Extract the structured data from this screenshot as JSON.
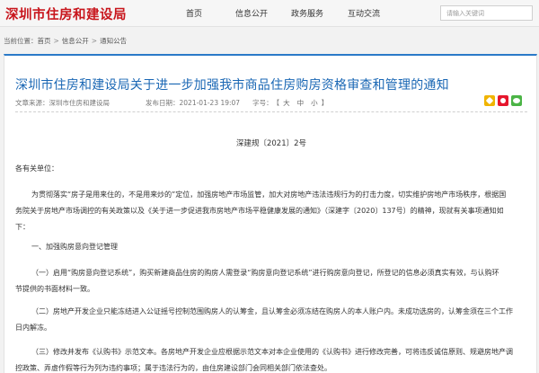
{
  "header": {
    "logo": "深圳市住房和建设局",
    "nav": [
      "首页",
      "信息公开",
      "政务服务",
      "互动交流"
    ],
    "search_placeholder": "请输入关键词"
  },
  "breadcrumb": {
    "prefix": "当前位置：",
    "items": [
      "首页",
      "信息公开",
      "通知公告"
    ],
    "separator": ">"
  },
  "article": {
    "title": "深圳市住房和建设局关于进一步加强我市商品住房购房资格审查和管理的通知",
    "source": "文章来源：深圳市住房和建设局",
    "date": "发布日期：2021-01-23 19:07",
    "font_label": "字号：",
    "font_open": "【",
    "font_sizes": [
      "大",
      "中",
      "小"
    ],
    "font_close": "】",
    "share_icons": [
      "qzone-icon",
      "weibo-icon",
      "wechat-icon"
    ],
    "doc_number": "深建规〔2021〕2号",
    "greeting": "各有关单位：",
    "p1_line1": "为贯彻落实“房子是用来住的，不是用来炒的”定位，加强房地产市场监管，加大对房地产违法违规行为的打击力度，切实维护房地产市场秩序，根据国",
    "p1_line2": "务院关于房地产市场调控的有关政策以及《关于进一步促进我市房地产市场平稳健康发展的通知》（深建字〔2020〕137号）的精神，现就有关事项通知如",
    "p1_line3": "下：",
    "section1": "一、加强购房意向登记管理",
    "p2_line1": "（一）启用“购房意向登记系统”，购买新建商品住房的购房人需登录“购房意向登记系统”进行购房意向登记，所登记的信息必须真实有效，与认购环",
    "p2_line2": "节提供的书面材料一致。",
    "p3_line1": "（二）房地产开发企业只能冻结进入公证摇号控制范围购房人的认筹金，且认筹金必须冻结在购房人的本人账户内。未成功选房的，认筹金须在三个工作",
    "p3_line2": "日内解冻。",
    "p4_line1": "（三）修改并发布《认购书》示范文本。各房地产开发企业应根据示范文本对本企业使用的《认购书》进行修改完善，可将违反诚信原则、规避房地产调",
    "p4_line2": "控政策、弄虚作假等行为列为违约事项；属于违法行为的，由住房建设部门会同相关部门依法查处。"
  },
  "colors": {
    "logo": "#c8161d",
    "title": "#1a67b4",
    "panel_top_border": "#2a7ac8"
  }
}
